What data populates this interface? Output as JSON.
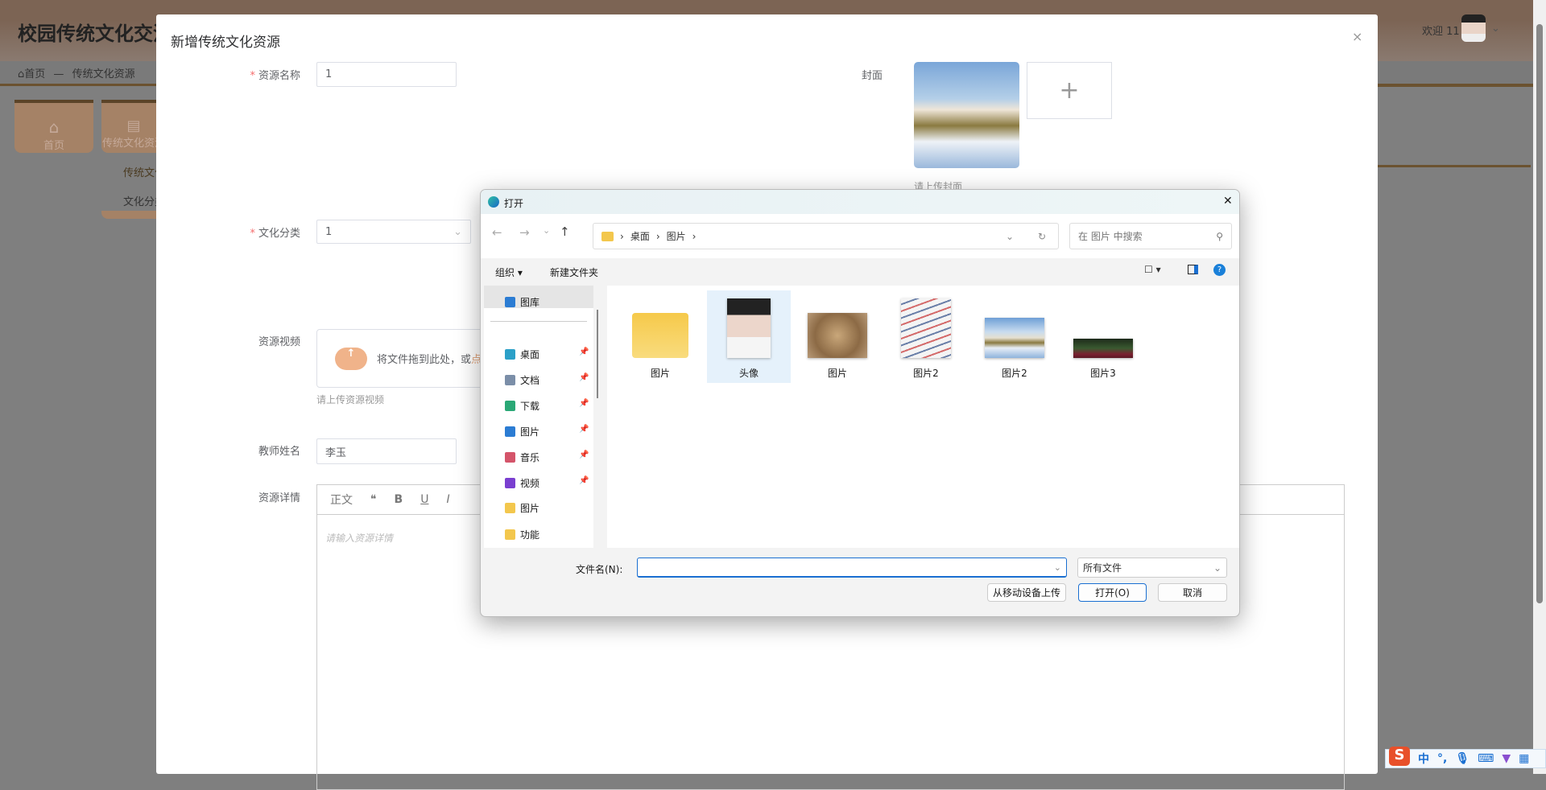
{
  "app": {
    "title": "校园传统文化交流",
    "welcome": "欢迎 11",
    "breadcrumb": {
      "home": "首页",
      "sep": "—",
      "current": "传统文化资源"
    },
    "menu": [
      {
        "label": "首页",
        "icon": "home-icon"
      },
      {
        "label": "传统文化资源",
        "icon": "archive-icon"
      }
    ],
    "submenu": [
      "传统文化",
      "文化分类"
    ]
  },
  "modal": {
    "title": "新增传统文化资源",
    "close": "×",
    "fields": {
      "name": {
        "label": "资源名称",
        "value": "1",
        "required": true
      },
      "cover": {
        "label": "封面",
        "hint": "请上传封面",
        "add": "+"
      },
      "category": {
        "label": "文化分类",
        "value": "1",
        "required": true
      },
      "video": {
        "label": "资源视频",
        "drop_text": "将文件拖到此处，或",
        "click_text": "点击上传",
        "hint": "请上传资源视频"
      },
      "teacher": {
        "label": "教师姓名",
        "value": "李玉"
      },
      "detail": {
        "label": "资源详情",
        "toolbar": [
          "正文",
          "❝",
          "B",
          "U",
          "I"
        ],
        "placeholder": "请输入资源详情"
      }
    }
  },
  "file_dialog": {
    "title": "打开",
    "close": "✕",
    "path": [
      "桌面",
      "图片"
    ],
    "search_placeholder": "在 图片 中搜索",
    "toolbar": {
      "organize": "组织 ▾",
      "new_folder": "新建文件夹"
    },
    "nav": [
      {
        "label": "图库",
        "pinned": false,
        "color": "#2b7cd3"
      },
      {
        "label": "桌面",
        "pinned": true,
        "color": "#2ba0c8"
      },
      {
        "label": "文档",
        "pinned": true,
        "color": "#7b8ea8"
      },
      {
        "label": "下载",
        "pinned": true,
        "color": "#2aa876"
      },
      {
        "label": "图片",
        "pinned": true,
        "color": "#2b7cd3"
      },
      {
        "label": "音乐",
        "pinned": true,
        "color": "#d4546a"
      },
      {
        "label": "视频",
        "pinned": true,
        "color": "#7a3fd0"
      },
      {
        "label": "图片",
        "pinned": false,
        "color": "#f3c74d"
      },
      {
        "label": "功能",
        "pinned": false,
        "color": "#f3c74d"
      }
    ],
    "files": [
      {
        "name": "图片",
        "type": "folder"
      },
      {
        "name": "头像",
        "type": "image",
        "selected": true
      },
      {
        "name": "图片",
        "type": "image"
      },
      {
        "name": "图片2",
        "type": "image"
      },
      {
        "name": "图片2",
        "type": "image"
      },
      {
        "name": "图片3",
        "type": "image"
      }
    ],
    "filename_label": "文件名(N):",
    "filename_value": "",
    "filetype": "所有文件",
    "buttons": {
      "mobile": "从移动设备上传",
      "open": "打开(O)",
      "cancel": "取消"
    }
  },
  "ime": {
    "logo": "S",
    "mode": "中",
    "punct": "°,"
  }
}
